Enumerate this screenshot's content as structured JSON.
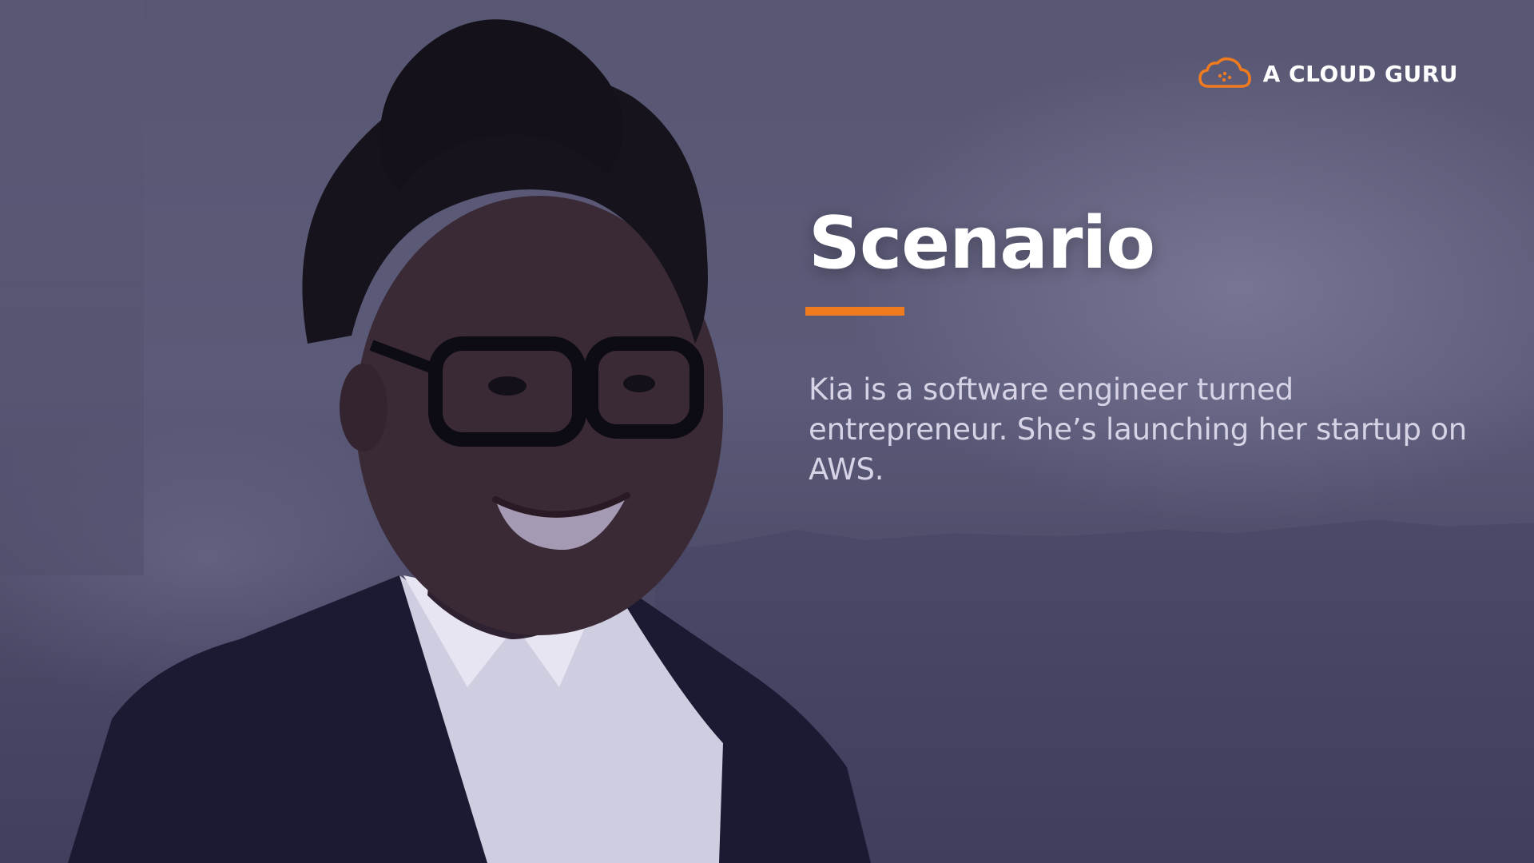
{
  "brand": {
    "name": "A CLOUD GURU",
    "icon": "cloud-logo-icon",
    "accent_color": "#f07b1f"
  },
  "slide": {
    "title": "Scenario",
    "description": "Kia is a software engineer turned entrepreneur. She’s launching her startup on AWS.",
    "overlay_color": "#54536f",
    "title_color": "#ffffff",
    "text_color": "#d6d3e6"
  }
}
